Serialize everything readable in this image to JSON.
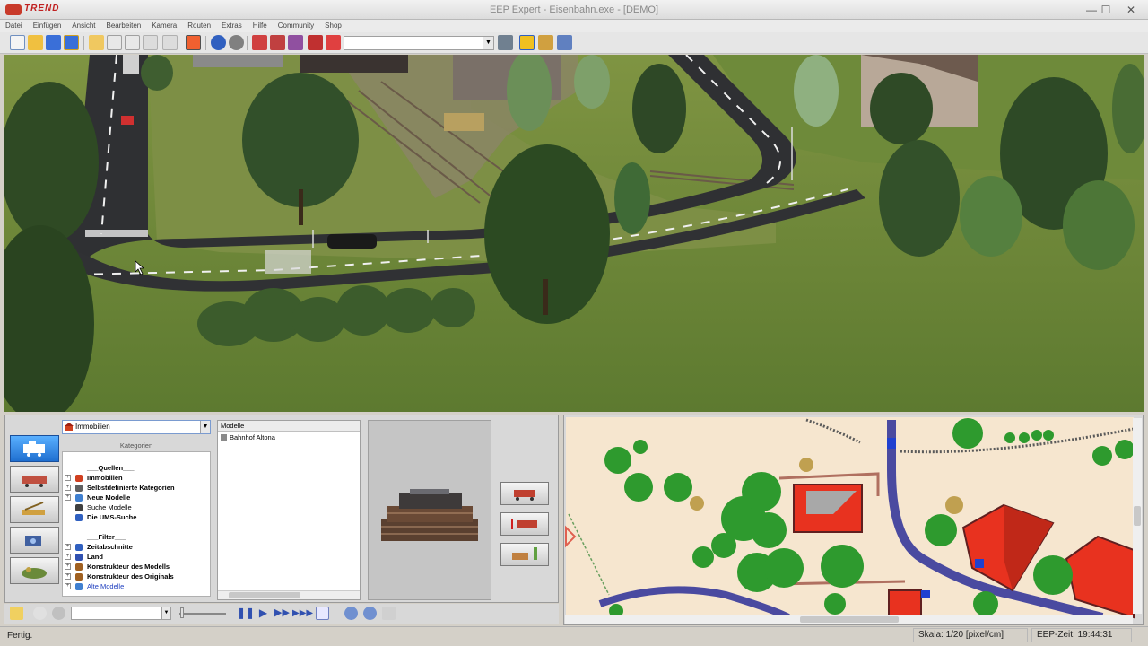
{
  "app": {
    "logo_text": "TREND",
    "title": "EEP Expert - Eisenbahn.exe - [DEMO]"
  },
  "window_controls": {
    "minimize": "—",
    "maximize": "☐",
    "close": "✕"
  },
  "menu": [
    "Datei",
    "Einfügen",
    "Ansicht",
    "Bearbeiten",
    "Kamera",
    "Routen",
    "Extras",
    "Hilfe",
    "Community",
    "Shop"
  ],
  "toolbar": {
    "icons": [
      "new-file-icon",
      "open-folder-icon",
      "save-icon",
      "save-as-icon",
      "copy-icon",
      "paste-icon",
      "window-icon",
      "cut-icon",
      "layers-icon",
      "map-icon",
      "undo-icon",
      "redo-icon",
      "train-track-icon",
      "signal-icon",
      "crane-icon",
      "rail-icon",
      "person-icon",
      "camera-icon",
      "bulb-icon",
      "settings-icon"
    ],
    "search_value": ""
  },
  "catalog": {
    "selected_category": "Immobilien",
    "categories_heading": "Kategorien",
    "tree": [
      {
        "label": "___Quellen___",
        "type": "hdr",
        "expander": ""
      },
      {
        "label": "Immobilien",
        "type": "bold",
        "expander": "+",
        "icon": "#d04020"
      },
      {
        "label": "Selbstdefinierte Kategorien",
        "type": "bold",
        "expander": "+",
        "icon": "#606060"
      },
      {
        "label": "Neue Modelle",
        "type": "bold",
        "expander": "+",
        "icon": "#4080d0"
      },
      {
        "label": "Suche Modelle",
        "type": "normal",
        "expander": "",
        "icon": "#404040"
      },
      {
        "label": "Die UMS-Suche",
        "type": "bold",
        "expander": "",
        "icon": "#3060c0"
      },
      {
        "label": "",
        "type": "spacer",
        "expander": ""
      },
      {
        "label": "___Filter___",
        "type": "hdr",
        "expander": ""
      },
      {
        "label": "Zeitabschnitte",
        "type": "bold",
        "expander": "+",
        "icon": "#3060c0"
      },
      {
        "label": "Land",
        "type": "bold",
        "expander": "+",
        "icon": "#3050b0"
      },
      {
        "label": "Konstrukteur des Modells",
        "type": "bold",
        "expander": "+",
        "icon": "#a06020"
      },
      {
        "label": "Konstrukteur des Originals",
        "type": "bold",
        "expander": "+",
        "icon": "#a06020"
      },
      {
        "label": "Alte Modelle",
        "type": "blue",
        "expander": "+",
        "icon": "#4080d0"
      }
    ],
    "models_header": "Modelle",
    "model_item": "Bahnhof Altona"
  },
  "status": {
    "left": "Fertig.",
    "scale": "Skala: 1/20 [pixel/cm]",
    "time": "EEP-Zeit: 19:44:31"
  },
  "colors": {
    "grass": "#6f8a3c",
    "map_bg": "#f6e6cf",
    "tree": "#2e9a2e",
    "house": "#e8321f",
    "track": "#4a4aa0"
  }
}
